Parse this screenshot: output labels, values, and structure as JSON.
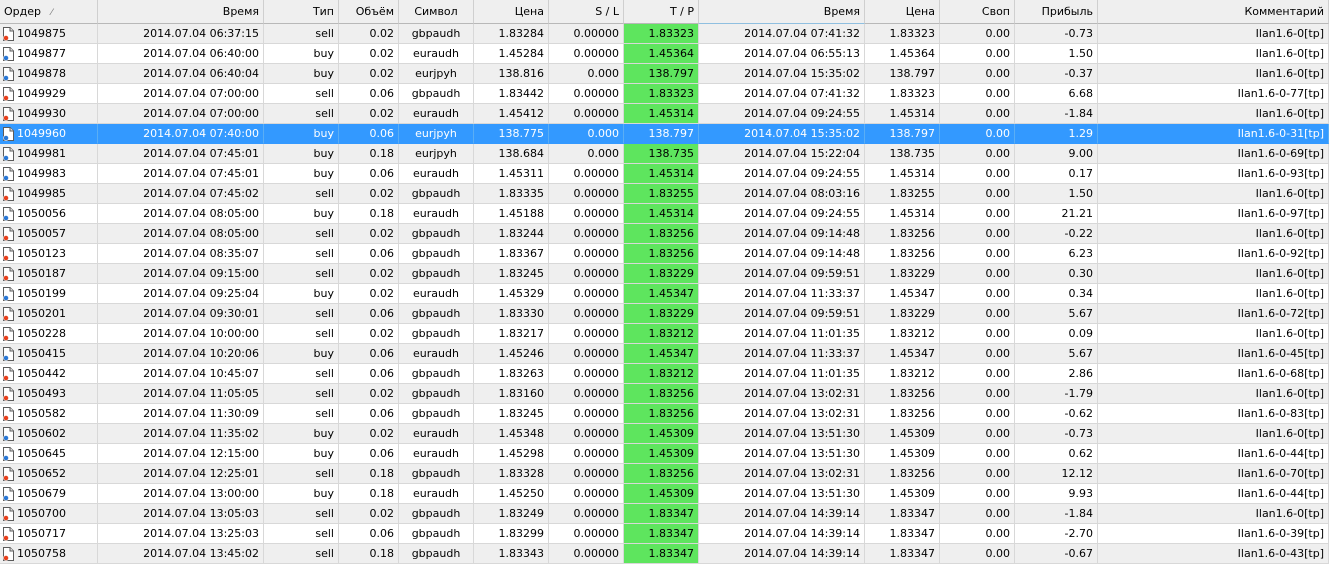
{
  "columns": [
    {
      "key": "order",
      "label": "Ордер",
      "align": "l"
    },
    {
      "key": "open_time",
      "label": "Время",
      "align": "r"
    },
    {
      "key": "type",
      "label": "Тип",
      "align": "r"
    },
    {
      "key": "volume",
      "label": "Объём",
      "align": "r"
    },
    {
      "key": "symbol",
      "label": "Символ",
      "align": "c"
    },
    {
      "key": "open_price",
      "label": "Цена",
      "align": "r"
    },
    {
      "key": "sl",
      "label": "S / L",
      "align": "r"
    },
    {
      "key": "tp",
      "label": "T / P",
      "align": "r"
    },
    {
      "key": "close_time",
      "label": "Время",
      "align": "r"
    },
    {
      "key": "close_price",
      "label": "Цена",
      "align": "r"
    },
    {
      "key": "swap",
      "label": "Своп",
      "align": "r"
    },
    {
      "key": "profit",
      "label": "Прибыль",
      "align": "r"
    },
    {
      "key": "comment",
      "label": "Комментарий",
      "align": "r"
    }
  ],
  "sort_indicator": "⁄",
  "sorted_column": "close_time",
  "selected_order": "1049960",
  "colors": {
    "tp_highlight": "#5ee55e",
    "selection": "#3399ff",
    "sell_icon": "#e8401c",
    "buy_icon": "#2a78d6"
  },
  "rows": [
    {
      "order": "1049875",
      "open_time": "2014.07.04 06:37:15",
      "type": "sell",
      "volume": "0.02",
      "symbol": "gbpaudh",
      "open_price": "1.83284",
      "sl": "0.00000",
      "tp": "1.83323",
      "close_time": "2014.07.04 07:41:32",
      "close_price": "1.83323",
      "swap": "0.00",
      "profit": "-0.73",
      "comment": "Ilan1.6-0[tp]"
    },
    {
      "order": "1049877",
      "open_time": "2014.07.04 06:40:00",
      "type": "buy",
      "volume": "0.02",
      "symbol": "euraudh",
      "open_price": "1.45284",
      "sl": "0.00000",
      "tp": "1.45364",
      "close_time": "2014.07.04 06:55:13",
      "close_price": "1.45364",
      "swap": "0.00",
      "profit": "1.50",
      "comment": "Ilan1.6-0[tp]"
    },
    {
      "order": "1049878",
      "open_time": "2014.07.04 06:40:04",
      "type": "buy",
      "volume": "0.02",
      "symbol": "eurjpyh",
      "open_price": "138.816",
      "sl": "0.000",
      "tp": "138.797",
      "close_time": "2014.07.04 15:35:02",
      "close_price": "138.797",
      "swap": "0.00",
      "profit": "-0.37",
      "comment": "Ilan1.6-0[tp]"
    },
    {
      "order": "1049929",
      "open_time": "2014.07.04 07:00:00",
      "type": "sell",
      "volume": "0.06",
      "symbol": "gbpaudh",
      "open_price": "1.83442",
      "sl": "0.00000",
      "tp": "1.83323",
      "close_time": "2014.07.04 07:41:32",
      "close_price": "1.83323",
      "swap": "0.00",
      "profit": "6.68",
      "comment": "Ilan1.6-0-77[tp]"
    },
    {
      "order": "1049930",
      "open_time": "2014.07.04 07:00:00",
      "type": "sell",
      "volume": "0.02",
      "symbol": "euraudh",
      "open_price": "1.45412",
      "sl": "0.00000",
      "tp": "1.45314",
      "close_time": "2014.07.04 09:24:55",
      "close_price": "1.45314",
      "swap": "0.00",
      "profit": "-1.84",
      "comment": "Ilan1.6-0[tp]"
    },
    {
      "order": "1049960",
      "open_time": "2014.07.04 07:40:00",
      "type": "buy",
      "volume": "0.06",
      "symbol": "eurjpyh",
      "open_price": "138.775",
      "sl": "0.000",
      "tp": "138.797",
      "close_time": "2014.07.04 15:35:02",
      "close_price": "138.797",
      "swap": "0.00",
      "profit": "1.29",
      "comment": "Ilan1.6-0-31[tp]"
    },
    {
      "order": "1049981",
      "open_time": "2014.07.04 07:45:01",
      "type": "buy",
      "volume": "0.18",
      "symbol": "eurjpyh",
      "open_price": "138.684",
      "sl": "0.000",
      "tp": "138.735",
      "close_time": "2014.07.04 15:22:04",
      "close_price": "138.735",
      "swap": "0.00",
      "profit": "9.00",
      "comment": "Ilan1.6-0-69[tp]"
    },
    {
      "order": "1049983",
      "open_time": "2014.07.04 07:45:01",
      "type": "buy",
      "volume": "0.06",
      "symbol": "euraudh",
      "open_price": "1.45311",
      "sl": "0.00000",
      "tp": "1.45314",
      "close_time": "2014.07.04 09:24:55",
      "close_price": "1.45314",
      "swap": "0.00",
      "profit": "0.17",
      "comment": "Ilan1.6-0-93[tp]"
    },
    {
      "order": "1049985",
      "open_time": "2014.07.04 07:45:02",
      "type": "sell",
      "volume": "0.02",
      "symbol": "gbpaudh",
      "open_price": "1.83335",
      "sl": "0.00000",
      "tp": "1.83255",
      "close_time": "2014.07.04 08:03:16",
      "close_price": "1.83255",
      "swap": "0.00",
      "profit": "1.50",
      "comment": "Ilan1.6-0[tp]"
    },
    {
      "order": "1050056",
      "open_time": "2014.07.04 08:05:00",
      "type": "buy",
      "volume": "0.18",
      "symbol": "euraudh",
      "open_price": "1.45188",
      "sl": "0.00000",
      "tp": "1.45314",
      "close_time": "2014.07.04 09:24:55",
      "close_price": "1.45314",
      "swap": "0.00",
      "profit": "21.21",
      "comment": "Ilan1.6-0-97[tp]"
    },
    {
      "order": "1050057",
      "open_time": "2014.07.04 08:05:00",
      "type": "sell",
      "volume": "0.02",
      "symbol": "gbpaudh",
      "open_price": "1.83244",
      "sl": "0.00000",
      "tp": "1.83256",
      "close_time": "2014.07.04 09:14:48",
      "close_price": "1.83256",
      "swap": "0.00",
      "profit": "-0.22",
      "comment": "Ilan1.6-0[tp]"
    },
    {
      "order": "1050123",
      "open_time": "2014.07.04 08:35:07",
      "type": "sell",
      "volume": "0.06",
      "symbol": "gbpaudh",
      "open_price": "1.83367",
      "sl": "0.00000",
      "tp": "1.83256",
      "close_time": "2014.07.04 09:14:48",
      "close_price": "1.83256",
      "swap": "0.00",
      "profit": "6.23",
      "comment": "Ilan1.6-0-92[tp]"
    },
    {
      "order": "1050187",
      "open_time": "2014.07.04 09:15:00",
      "type": "sell",
      "volume": "0.02",
      "symbol": "gbpaudh",
      "open_price": "1.83245",
      "sl": "0.00000",
      "tp": "1.83229",
      "close_time": "2014.07.04 09:59:51",
      "close_price": "1.83229",
      "swap": "0.00",
      "profit": "0.30",
      "comment": "Ilan1.6-0[tp]"
    },
    {
      "order": "1050199",
      "open_time": "2014.07.04 09:25:04",
      "type": "buy",
      "volume": "0.02",
      "symbol": "euraudh",
      "open_price": "1.45329",
      "sl": "0.00000",
      "tp": "1.45347",
      "close_time": "2014.07.04 11:33:37",
      "close_price": "1.45347",
      "swap": "0.00",
      "profit": "0.34",
      "comment": "Ilan1.6-0[tp]"
    },
    {
      "order": "1050201",
      "open_time": "2014.07.04 09:30:01",
      "type": "sell",
      "volume": "0.06",
      "symbol": "gbpaudh",
      "open_price": "1.83330",
      "sl": "0.00000",
      "tp": "1.83229",
      "close_time": "2014.07.04 09:59:51",
      "close_price": "1.83229",
      "swap": "0.00",
      "profit": "5.67",
      "comment": "Ilan1.6-0-72[tp]"
    },
    {
      "order": "1050228",
      "open_time": "2014.07.04 10:00:00",
      "type": "sell",
      "volume": "0.02",
      "symbol": "gbpaudh",
      "open_price": "1.83217",
      "sl": "0.00000",
      "tp": "1.83212",
      "close_time": "2014.07.04 11:01:35",
      "close_price": "1.83212",
      "swap": "0.00",
      "profit": "0.09",
      "comment": "Ilan1.6-0[tp]"
    },
    {
      "order": "1050415",
      "open_time": "2014.07.04 10:20:06",
      "type": "buy",
      "volume": "0.06",
      "symbol": "euraudh",
      "open_price": "1.45246",
      "sl": "0.00000",
      "tp": "1.45347",
      "close_time": "2014.07.04 11:33:37",
      "close_price": "1.45347",
      "swap": "0.00",
      "profit": "5.67",
      "comment": "Ilan1.6-0-45[tp]"
    },
    {
      "order": "1050442",
      "open_time": "2014.07.04 10:45:07",
      "type": "sell",
      "volume": "0.06",
      "symbol": "gbpaudh",
      "open_price": "1.83263",
      "sl": "0.00000",
      "tp": "1.83212",
      "close_time": "2014.07.04 11:01:35",
      "close_price": "1.83212",
      "swap": "0.00",
      "profit": "2.86",
      "comment": "Ilan1.6-0-68[tp]"
    },
    {
      "order": "1050493",
      "open_time": "2014.07.04 11:05:05",
      "type": "sell",
      "volume": "0.02",
      "symbol": "gbpaudh",
      "open_price": "1.83160",
      "sl": "0.00000",
      "tp": "1.83256",
      "close_time": "2014.07.04 13:02:31",
      "close_price": "1.83256",
      "swap": "0.00",
      "profit": "-1.79",
      "comment": "Ilan1.6-0[tp]"
    },
    {
      "order": "1050582",
      "open_time": "2014.07.04 11:30:09",
      "type": "sell",
      "volume": "0.06",
      "symbol": "gbpaudh",
      "open_price": "1.83245",
      "sl": "0.00000",
      "tp": "1.83256",
      "close_time": "2014.07.04 13:02:31",
      "close_price": "1.83256",
      "swap": "0.00",
      "profit": "-0.62",
      "comment": "Ilan1.6-0-83[tp]"
    },
    {
      "order": "1050602",
      "open_time": "2014.07.04 11:35:02",
      "type": "buy",
      "volume": "0.02",
      "symbol": "euraudh",
      "open_price": "1.45348",
      "sl": "0.00000",
      "tp": "1.45309",
      "close_time": "2014.07.04 13:51:30",
      "close_price": "1.45309",
      "swap": "0.00",
      "profit": "-0.73",
      "comment": "Ilan1.6-0[tp]"
    },
    {
      "order": "1050645",
      "open_time": "2014.07.04 12:15:00",
      "type": "buy",
      "volume": "0.06",
      "symbol": "euraudh",
      "open_price": "1.45298",
      "sl": "0.00000",
      "tp": "1.45309",
      "close_time": "2014.07.04 13:51:30",
      "close_price": "1.45309",
      "swap": "0.00",
      "profit": "0.62",
      "comment": "Ilan1.6-0-44[tp]"
    },
    {
      "order": "1050652",
      "open_time": "2014.07.04 12:25:01",
      "type": "sell",
      "volume": "0.18",
      "symbol": "gbpaudh",
      "open_price": "1.83328",
      "sl": "0.00000",
      "tp": "1.83256",
      "close_time": "2014.07.04 13:02:31",
      "close_price": "1.83256",
      "swap": "0.00",
      "profit": "12.12",
      "comment": "Ilan1.6-0-70[tp]"
    },
    {
      "order": "1050679",
      "open_time": "2014.07.04 13:00:00",
      "type": "buy",
      "volume": "0.18",
      "symbol": "euraudh",
      "open_price": "1.45250",
      "sl": "0.00000",
      "tp": "1.45309",
      "close_time": "2014.07.04 13:51:30",
      "close_price": "1.45309",
      "swap": "0.00",
      "profit": "9.93",
      "comment": "Ilan1.6-0-44[tp]"
    },
    {
      "order": "1050700",
      "open_time": "2014.07.04 13:05:03",
      "type": "sell",
      "volume": "0.02",
      "symbol": "gbpaudh",
      "open_price": "1.83249",
      "sl": "0.00000",
      "tp": "1.83347",
      "close_time": "2014.07.04 14:39:14",
      "close_price": "1.83347",
      "swap": "0.00",
      "profit": "-1.84",
      "comment": "Ilan1.6-0[tp]"
    },
    {
      "order": "1050717",
      "open_time": "2014.07.04 13:25:03",
      "type": "sell",
      "volume": "0.06",
      "symbol": "gbpaudh",
      "open_price": "1.83299",
      "sl": "0.00000",
      "tp": "1.83347",
      "close_time": "2014.07.04 14:39:14",
      "close_price": "1.83347",
      "swap": "0.00",
      "profit": "-2.70",
      "comment": "Ilan1.6-0-39[tp]"
    },
    {
      "order": "1050758",
      "open_time": "2014.07.04 13:45:02",
      "type": "sell",
      "volume": "0.18",
      "symbol": "gbpaudh",
      "open_price": "1.83343",
      "sl": "0.00000",
      "tp": "1.83347",
      "close_time": "2014.07.04 14:39:14",
      "close_price": "1.83347",
      "swap": "0.00",
      "profit": "-0.67",
      "comment": "Ilan1.6-0-43[tp]"
    }
  ]
}
